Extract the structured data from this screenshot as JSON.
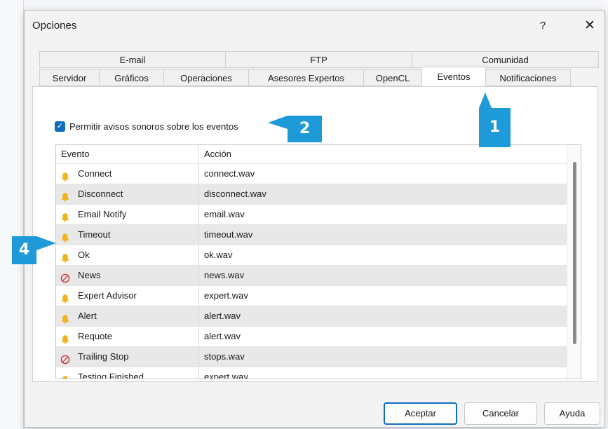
{
  "dialog": {
    "title": "Opciones",
    "help_glyph": "?",
    "close_glyph": "✕"
  },
  "tabs": {
    "back_row": [
      {
        "label": "E-mail",
        "active": false
      },
      {
        "label": "FTP",
        "active": false
      },
      {
        "label": "Comunidad",
        "active": false
      }
    ],
    "front_row": [
      {
        "label": "Servidor",
        "active": false
      },
      {
        "label": "Gráficos",
        "active": false
      },
      {
        "label": "Operaciones",
        "active": false
      },
      {
        "label": "Asesores Expertos",
        "active": false
      },
      {
        "label": "OpenCL",
        "active": false
      },
      {
        "label": "Eventos",
        "active": true
      },
      {
        "label": "Notificaciones",
        "active": false
      }
    ]
  },
  "events_panel": {
    "sound_checkbox": {
      "label": "Permitir avisos sonoros sobre los eventos",
      "checked": true
    },
    "columns": [
      "Evento",
      "Acción"
    ],
    "rows": [
      {
        "event": "Connect",
        "action": "connect.wav",
        "icon": "bell-icon",
        "enabled": true
      },
      {
        "event": "Disconnect",
        "action": "disconnect.wav",
        "icon": "bell-icon",
        "enabled": true
      },
      {
        "event": "Email Notify",
        "action": "email.wav",
        "icon": "bell-icon",
        "enabled": true
      },
      {
        "event": "Timeout",
        "action": "timeout.wav",
        "icon": "bell-icon",
        "enabled": true
      },
      {
        "event": "Ok",
        "action": "ok.wav",
        "icon": "bell-icon",
        "enabled": true
      },
      {
        "event": "News",
        "action": "news.wav",
        "icon": "disabled-icon",
        "enabled": false
      },
      {
        "event": "Expert Advisor",
        "action": "expert.wav",
        "icon": "bell-icon",
        "enabled": true
      },
      {
        "event": "Alert",
        "action": "alert.wav",
        "icon": "bell-icon",
        "enabled": true
      },
      {
        "event": "Requote",
        "action": "alert.wav",
        "icon": "bell-icon",
        "enabled": true
      },
      {
        "event": "Trailing Stop",
        "action": "stops.wav",
        "icon": "disabled-icon",
        "enabled": false
      },
      {
        "event": "Testing Finished",
        "action": "expert.wav",
        "icon": "bell-icon",
        "enabled": true
      }
    ]
  },
  "buttons": {
    "accept": "Aceptar",
    "cancel": "Cancelar",
    "help": "Ayuda"
  },
  "callouts": {
    "one": "1",
    "two": "2",
    "four": "4"
  },
  "colors": {
    "accent": "#0f6cbd",
    "callout": "#1e9ad9",
    "bell": "#f2b31b",
    "disabled": "#d13438"
  }
}
